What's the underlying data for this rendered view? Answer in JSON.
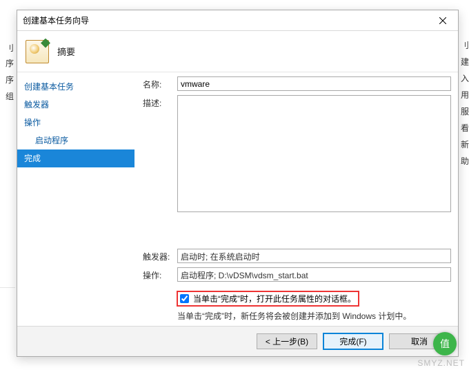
{
  "bg_left": [
    "刂序",
    "序",
    "组"
  ],
  "bg_right": [
    "刂",
    "建",
    "入",
    "用",
    "服",
    "看",
    "新",
    "助"
  ],
  "watermark": "SMYZ.NET",
  "badge": "值",
  "dialog": {
    "title": "创建基本任务向导",
    "header_title": "摘要",
    "sidebar": {
      "items": [
        {
          "label": "创建基本任务",
          "indent": false
        },
        {
          "label": "触发器",
          "indent": false
        },
        {
          "label": "操作",
          "indent": false
        },
        {
          "label": "启动程序",
          "indent": true
        },
        {
          "label": "完成",
          "indent": false,
          "selected": true
        }
      ]
    },
    "form": {
      "name_label": "名称:",
      "name_value": "vmware",
      "desc_label": "描述:",
      "desc_value": "",
      "trigger_label": "触发器:",
      "trigger_value": "启动时; 在系统启动时",
      "action_label": "操作:",
      "action_value": "启动程序; D:\\vDSM\\vdsm_start.bat",
      "open_props_checked": true,
      "open_props_label": "当单击“完成”时，打开此任务属性的对话框。",
      "note": "当单击“完成”时，新任务将会被创建并添加到 Windows 计划中。"
    },
    "footer": {
      "back": "< 上一步(B)",
      "finish": "完成(F)",
      "cancel": "取消"
    }
  }
}
